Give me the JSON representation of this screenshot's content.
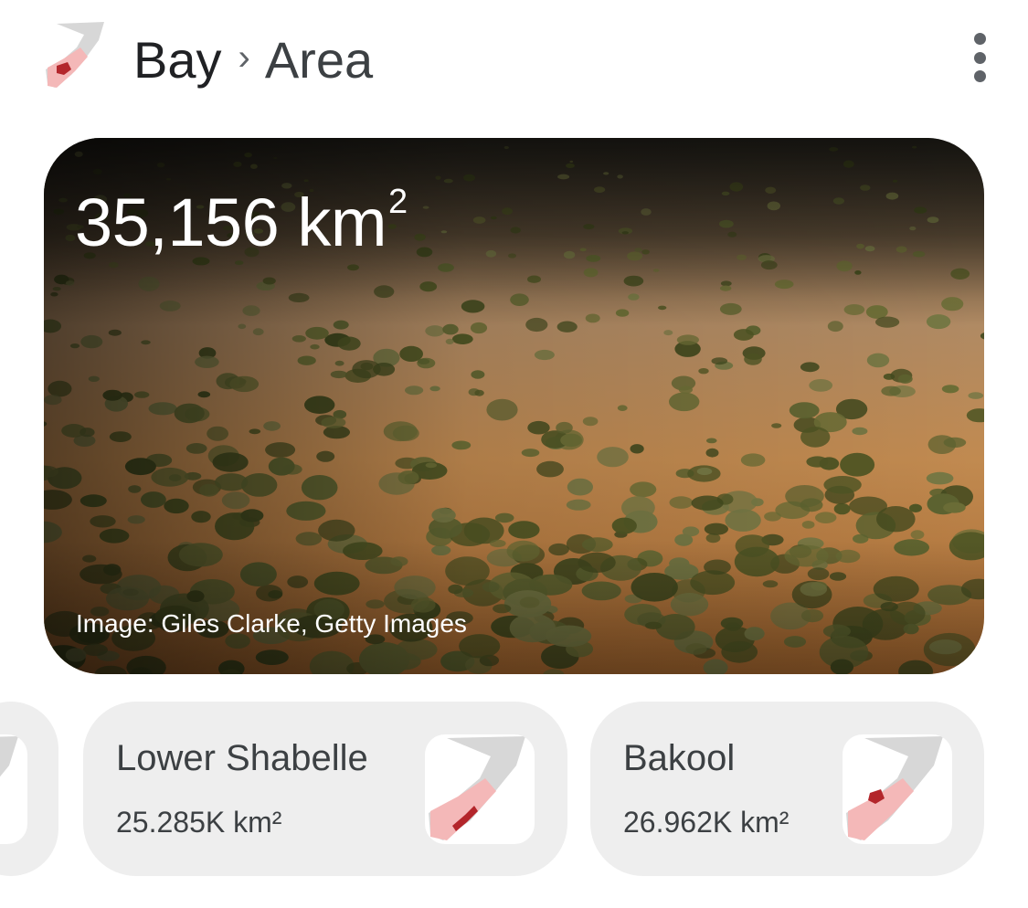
{
  "header": {
    "breadcrumb_parent": "Bay",
    "separator": "›",
    "breadcrumb_current": "Area",
    "icon": "somalia-region-map-icon",
    "more_icon": "more-vert-icon"
  },
  "hero": {
    "value": "35,156 km",
    "value_superscript": "2",
    "image_credit": "Image: Giles Clarke, Getty Images"
  },
  "related": [
    {
      "name": "",
      "value": "",
      "icon": "region-map-icon"
    },
    {
      "name": "Lower Shabelle",
      "value": "25.285K km²",
      "icon": "lower-shabelle-map-icon"
    },
    {
      "name": "Bakool",
      "value": "26.962K km²",
      "icon": "bakool-map-icon"
    }
  ],
  "colors": {
    "text_primary": "#202124",
    "card_bg": "#eeeeee",
    "map_grey": "#d7d7d7",
    "map_pink": "#f4b8b8",
    "map_highlight": "#b3262b",
    "earth": "#b57a42",
    "vegetation": "#5a5f2a"
  }
}
